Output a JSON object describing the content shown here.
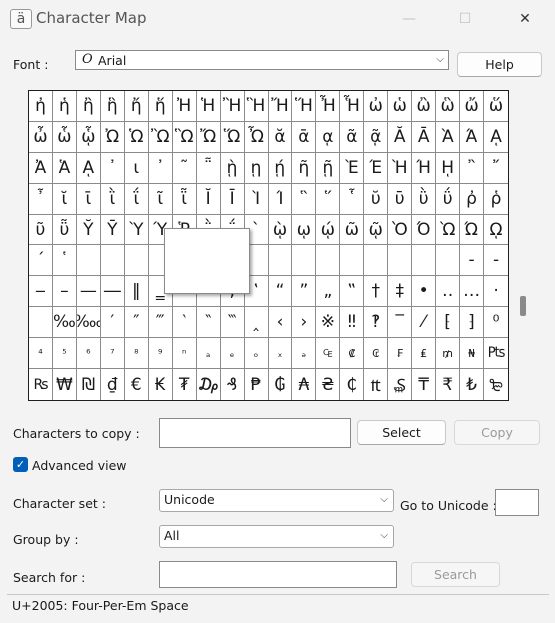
{
  "window": {
    "title": "Character Map",
    "minimize": "—",
    "maximize": "☐",
    "close": "✕"
  },
  "font": {
    "label": "Font :",
    "glyph": "O",
    "value": "Arial",
    "help_button": "Help"
  },
  "grid": {
    "cells": [
      "ἠ",
      "ἡ",
      "ἢ",
      "ἣ",
      "ἤ",
      "ἥ",
      "Ἠ",
      "Ἡ",
      "Ἢ",
      "Ἣ",
      "Ἤ",
      "Ἥ",
      "Ἦ",
      "Ἧ",
      "ὠ",
      "ὡ",
      "ὢ",
      "ὣ",
      "ὤ",
      "ὥ",
      "ὦ",
      "ὧ",
      "ᾧ",
      "Ὠ",
      "Ὡ",
      "Ὢ",
      "Ὣ",
      "Ὤ",
      "Ὥ",
      "Ὦ",
      "ᾰ",
      "ᾱ",
      "ᾳ",
      "ᾶ",
      "ᾷ",
      "Ᾰ",
      "Ᾱ",
      "Ὰ",
      "Ά",
      "ᾼ",
      "Ἀ",
      "Ἁ",
      "ᾼ",
      "᾽",
      "ι",
      "᾿",
      "῀",
      "῁",
      "ῂ",
      "ῃ",
      "ῄ",
      "ῆ",
      "ῇ",
      "Ὲ",
      "Έ",
      "Ὴ",
      "Ή",
      "ῌ",
      "῍",
      "῎",
      "῏",
      "ῐ",
      "ῑ",
      "ῒ",
      "ΐ",
      "ῖ",
      "ῗ",
      "Ῐ",
      "Ῑ",
      "Ὶ",
      "Ί",
      "῝",
      "῞",
      "῟",
      "ῠ",
      "ῡ",
      "ῢ",
      "ΰ",
      "ῤ",
      "ῥ",
      "ῦ",
      "ῧ",
      "Ῠ",
      "Ῡ",
      "Ὺ",
      "Ύ",
      "Ῥ",
      "῭",
      "΅",
      "`",
      "ῲ",
      "ῳ",
      "ῴ",
      "ῶ",
      "ῷ",
      "Ὸ",
      "Ό",
      "Ὼ",
      "Ώ",
      "ῼ",
      "´",
      "῾",
      " ",
      " ",
      " ",
      " ",
      " ",
      " ",
      " ",
      " ",
      " ",
      " ",
      " ",
      " ",
      " ",
      " ",
      " ",
      " ",
      "‐",
      "‑",
      "‒",
      "–",
      "—",
      "―",
      "‖",
      "‗",
      "‘",
      "’",
      "‚",
      "‛",
      "“",
      "”",
      "„",
      "‟",
      "†",
      "‡",
      "•",
      "‥",
      "…",
      "‧",
      " ",
      "‰",
      "‱",
      "′",
      "″",
      "‴",
      "‵",
      "‶",
      "‷",
      "‸",
      "‹",
      "›",
      "※",
      "‼",
      "‽",
      "‾",
      "⁄",
      "⁅",
      "⁆",
      "⁰",
      "⁴",
      "⁵",
      "⁶",
      "⁷",
      "⁸",
      "⁹",
      "ⁿ",
      "ₐ",
      "ₑ",
      "ₒ",
      "ₓ",
      "ₔ",
      "₠",
      "₡",
      "₢",
      "₣",
      "₤",
      "₥",
      "₦",
      "₧",
      "₨",
      "₩",
      "₪",
      "₫",
      "€",
      "₭",
      "₮",
      "₯",
      "₰",
      "₱",
      "₲",
      "₳",
      "₴",
      "₵",
      "₶",
      "₷",
      "₸",
      "₹",
      "₺",
      "₻"
    ]
  },
  "copy": {
    "label": "Characters to copy :",
    "value": "",
    "select_button": "Select",
    "copy_button": "Copy"
  },
  "advanced": {
    "checkmark": "✓",
    "label": "Advanced view",
    "checked": true
  },
  "charset": {
    "label": "Character set :",
    "value": "Unicode",
    "goto_label": "Go to Unicode :",
    "goto_value": ""
  },
  "groupby": {
    "label": "Group by :",
    "value": "All"
  },
  "search": {
    "label": "Search for :",
    "value": "",
    "button": "Search"
  },
  "status": {
    "text": "U+2005: Four-Per-Em Space"
  }
}
